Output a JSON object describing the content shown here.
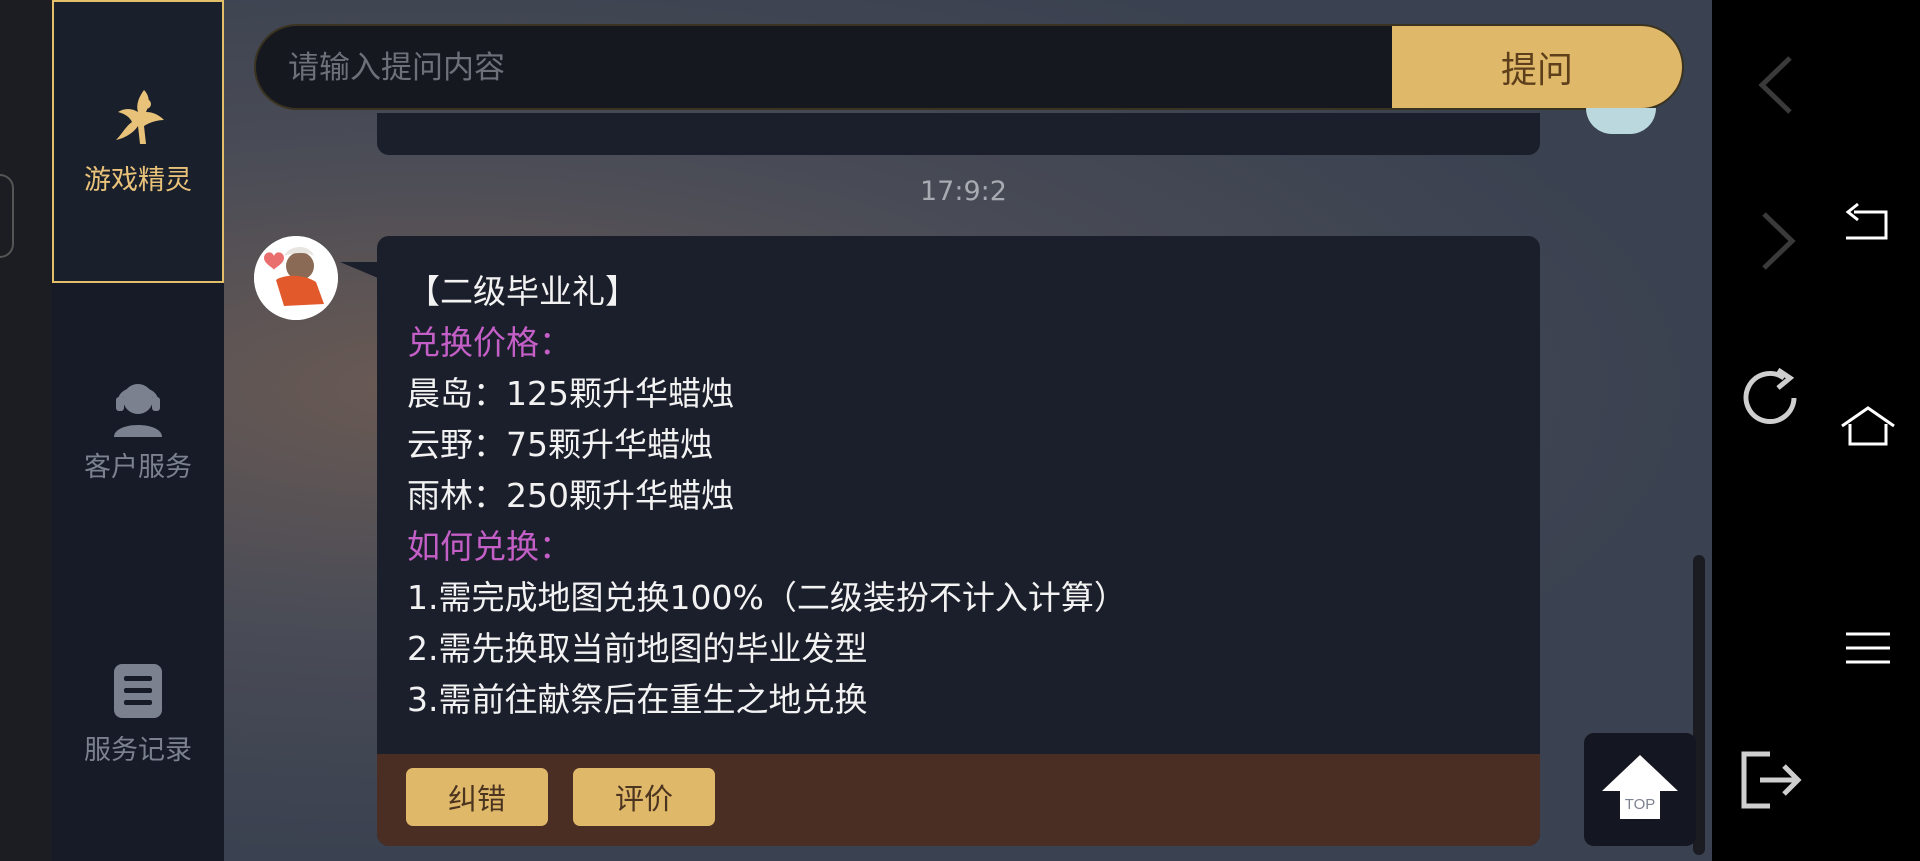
{
  "sidebar": {
    "tabs": [
      {
        "label": "游戏精灵",
        "icon": "fairy-icon",
        "active": true
      },
      {
        "label": "客户服务",
        "icon": "customer-service-icon",
        "active": false
      },
      {
        "label": "服务记录",
        "icon": "records-icon",
        "active": false
      }
    ]
  },
  "search": {
    "placeholder": "请输入提问内容",
    "value": "",
    "button_label": "提问"
  },
  "chat": {
    "timestamp": "17:9:2",
    "message": {
      "title": "【二级毕业礼】",
      "price_heading": "兑换价格：",
      "prices": [
        "晨岛：125颗升华蜡烛",
        "云野：75颗升华蜡烛",
        "雨林：250颗升华蜡烛"
      ],
      "how_heading": "如何兑换：",
      "steps": [
        "1.需完成地图兑换100%（二级装扮不计入计算）",
        "2.需先换取当前地图的毕业发型",
        "3.需前往献祭后在重生之地兑换"
      ],
      "actions": {
        "correct_label": "纠错",
        "rate_label": "评价"
      }
    }
  },
  "top_button": {
    "label": "TOP"
  },
  "right_panel": {
    "icons": [
      "back-chevron-icon",
      "forward-chevron-icon",
      "refresh-icon",
      "return-icon",
      "home-icon",
      "menu-icon",
      "exit-icon"
    ]
  }
}
